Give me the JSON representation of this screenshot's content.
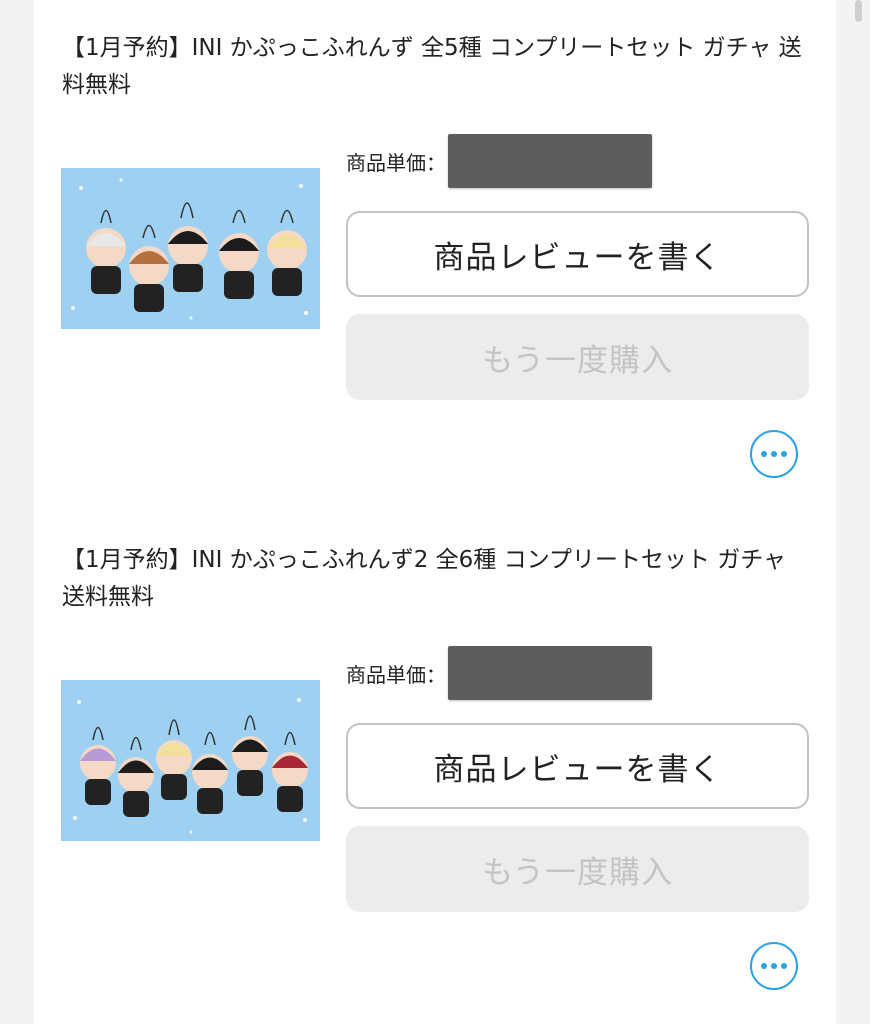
{
  "products": [
    {
      "title": "【1月予約】INI かぷっこふれんず 全5種 コンプリートセット ガチャ 送料無料",
      "price_label": "商品単価：",
      "review_label": "商品レビューを書く",
      "rebuy_label": "もう一度購入",
      "more_icon": "more-dots-icon"
    },
    {
      "title": "【1月予約】INI かぷっこふれんず2 全6種 コンプリートセット ガチャ 送料無料",
      "price_label": "商品単価：",
      "review_label": "商品レビューを書く",
      "rebuy_label": "もう一度購入",
      "more_icon": "more-dots-icon"
    }
  ],
  "colors": {
    "accent": "#2aa3e0",
    "image_background": "#9dd0f1",
    "redaction": "#5d5d5d"
  }
}
